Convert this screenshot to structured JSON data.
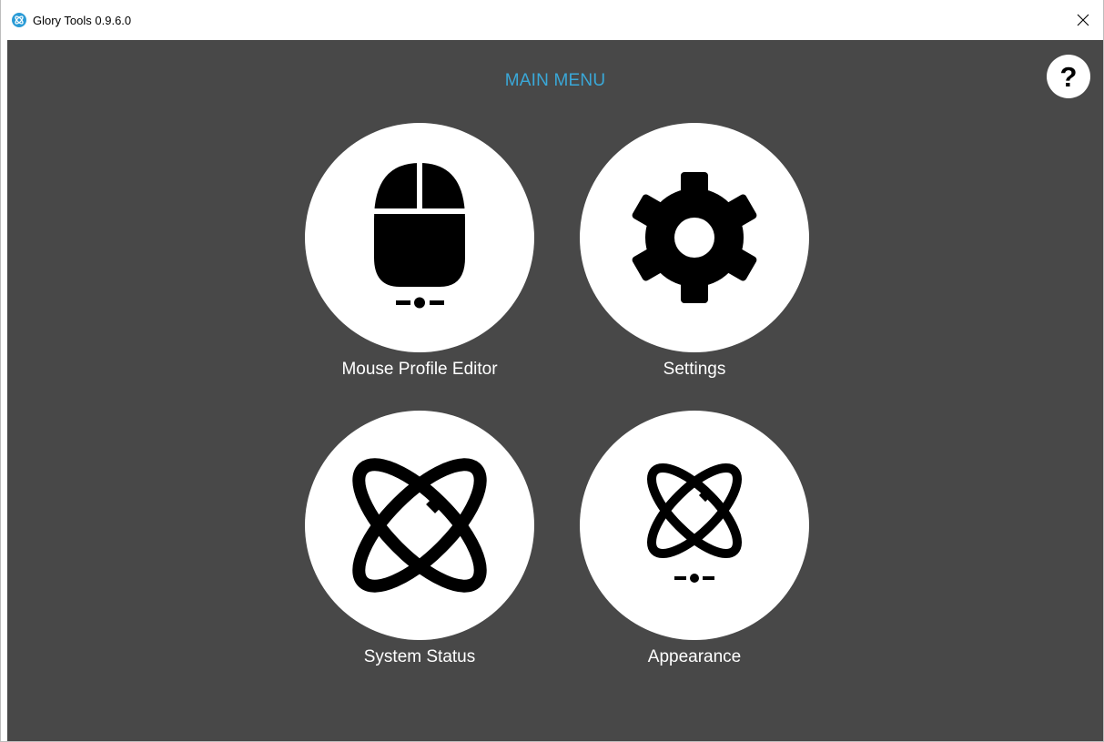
{
  "window": {
    "title": "Glory Tools 0.9.6.0",
    "accent_color": "#3aa8d8",
    "background_color": "#484848"
  },
  "main": {
    "heading": "MAIN MENU",
    "help_label": "?",
    "tiles": [
      {
        "label": "Mouse Profile Editor",
        "icon": "mouse-icon"
      },
      {
        "label": "Settings",
        "icon": "gear-icon"
      },
      {
        "label": "System Status",
        "icon": "glory-logo-icon"
      },
      {
        "label": "Appearance",
        "icon": "glory-logo-slider-icon"
      }
    ]
  }
}
